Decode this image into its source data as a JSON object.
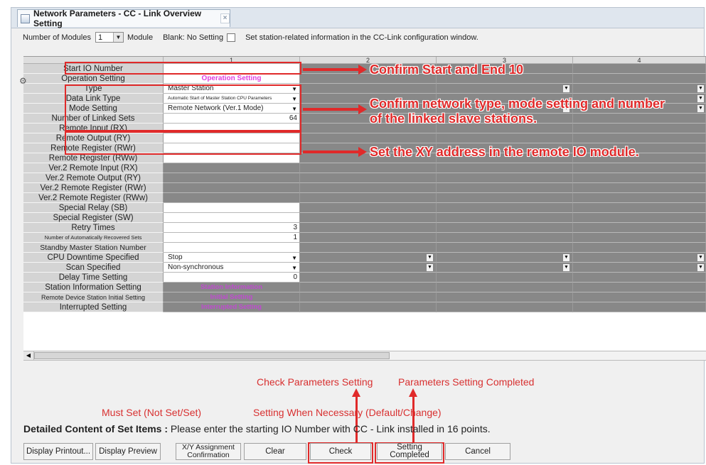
{
  "window": {
    "tab_title": "Network Parameters - CC - Link Overview Setting",
    "tab_close": "×"
  },
  "topbar": {
    "modules_label": "Number of Modules",
    "modules_value": "1",
    "module_unit": "Module",
    "blank_label": "Blank: No Setting",
    "info_text": "Set station-related information in the CC-Link configuration window."
  },
  "columns": [
    "1",
    "2",
    "3",
    "4"
  ],
  "rows": {
    "start_io": "Start IO Number",
    "operation_setting": "Operation Setting",
    "type": "Type",
    "data_link_type": "Data Link Type",
    "mode_setting": "Mode Setting",
    "linked_sets": "Number of Linked Sets",
    "remote_input": "Remote Input (RX)",
    "remote_output": "Remote Output (RY)",
    "remote_reg_rwr": "Remote Register (RWr)",
    "remote_reg_rww": "Remote Register (RWw)",
    "v2_input": "Ver.2 Remote Input (RX)",
    "v2_output": "Ver.2 Remote Output (RY)",
    "v2_rwr": "Ver.2 Remote Register (RWr)",
    "v2_rww": "Ver.2 Remote Register (RWw)",
    "special_relay": "Special Relay (SB)",
    "special_register": "Special Register (SW)",
    "retry_times": "Retry Times",
    "auto_recovered": "Number of Automatically Recovered Sets",
    "standby_master": "Standby Master Station Number",
    "cpu_downtime": "CPU Downtime Specified",
    "scan_specified": "Scan Specified",
    "delay_time": "Delay Time Setting",
    "station_info": "Station Information Setting",
    "remote_device_init": "Remote Device Station Initial Setting",
    "interrupted": "Interrupted Setting"
  },
  "values": {
    "operation_link": "Operation Setting",
    "type": "Master Station",
    "data_link_type": "Automatic Start of Master Station CPU Parameters",
    "mode_setting": "Remote Network (Ver.1 Mode)",
    "linked_sets": "64",
    "retry_times": "3",
    "auto_recovered": "1",
    "cpu_downtime": "Stop",
    "scan_specified": "Non-synchronous",
    "delay_time": "0",
    "station_info_link": "Station Information",
    "initial_setting_link": "Initial Setting",
    "interrupted_link": "Interrupted Setting"
  },
  "annotations": {
    "a1": "Confirm Start and End 10",
    "a2_line1": "Confirm network type, mode setting and number",
    "a2_line2": "of the linked slave stations.",
    "a3": "Set the XY address in the remote IO module.",
    "check_params": "Check Parameters Setting",
    "params_completed": "Parameters Setting Completed"
  },
  "legend": {
    "must_set": "Must Set (Not Set/Set)",
    "when_necessary": "Setting When Necessary (Default/Change)"
  },
  "detail": {
    "label": "Detailed Content of Set Items :",
    "text": "Please enter the starting IO Number with CC - Link installed in 16 points."
  },
  "buttons": {
    "display_printout": "Display Printout...",
    "display_preview": "Display Preview",
    "xy_assignment": "X/Y Assignment Confirmation",
    "clear": "Clear",
    "check": "Check",
    "setting_completed": "Setting Completed",
    "cancel": "Cancel"
  },
  "colors": {
    "annotation_red": "#e02a2a",
    "label_gray": "#d4d4d4",
    "disabled_gray": "#888888",
    "link_magenta": "#e040e0"
  }
}
